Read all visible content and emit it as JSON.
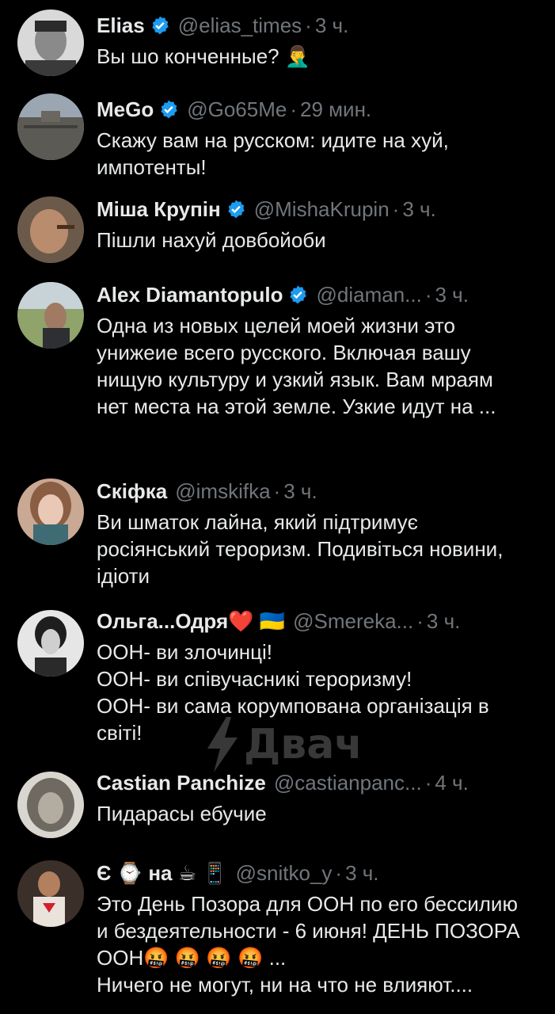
{
  "replies": [
    {
      "name": "Elias",
      "verified": true,
      "handle": "@elias_times",
      "time": "3 ч.",
      "text": "Вы шо конченные? 🤦‍♂️",
      "avatar": "avatar-elias"
    },
    {
      "name": "MeGo",
      "verified": true,
      "handle": "@Go65Me",
      "time": "29 мин.",
      "text": "Скажу вам на русском: идите на хуй, импотенты!",
      "avatar": "avatar-mego"
    },
    {
      "name": "Міша Крупін",
      "verified": true,
      "handle": "@MishaKrupin",
      "time": "3 ч.",
      "text": "Пішли нахуй довбойоби",
      "avatar": "avatar-misha"
    },
    {
      "name": "Alex Diamantopulo",
      "verified": true,
      "handle": "@diaman...",
      "time": "3 ч.",
      "text": "Одна из новых целей моей жизни это унижеие всего русского. Включая вашу нищую культуру и узкий язык. Вам мраям нет места на этой земле. Узкие идут на ...",
      "avatar": "avatar-alex"
    },
    {
      "name": "Скіфка",
      "verified": false,
      "handle": "@imskifka",
      "time": "3 ч.",
      "text": "Ви шматок лайна, який підтримує росіянський тероризм. Подивіться новини, ідіоти",
      "avatar": "avatar-skifka"
    },
    {
      "name": "Ольга...Одря❤️ 🇺🇦",
      "verified": false,
      "handle": "@Smereka...",
      "time": "3 ч.",
      "text": "ООН- ви злочинці!\nООН- ви співучасникі тероризму!\nООН- ви сама корумпована організація в світі!",
      "avatar": "avatar-olga"
    },
    {
      "name": "Castian Panchize",
      "verified": false,
      "handle": "@castianpanc...",
      "time": "4 ч.",
      "text": "Пидарасы ебучие",
      "avatar": "avatar-castian"
    },
    {
      "name": "Є ⌚ на ☕ 📱",
      "verified": false,
      "handle": "@snitko_y",
      "time": "3 ч.",
      "text": "Это День Позора для ООН по его бессилию и бездеятельности - 6 июня! ДЕНЬ ПОЗОРА ООН🤬 🤬 🤬 🤬 ...\nНичего не могут, ни на что не влияют....",
      "avatar": "avatar-snitko"
    }
  ],
  "watermark": "Двач",
  "colors": {
    "background": "#000000",
    "text": "#e7e9ea",
    "muted": "#71767b",
    "verified": "#1d9bf0",
    "thread_line": "#333639"
  }
}
